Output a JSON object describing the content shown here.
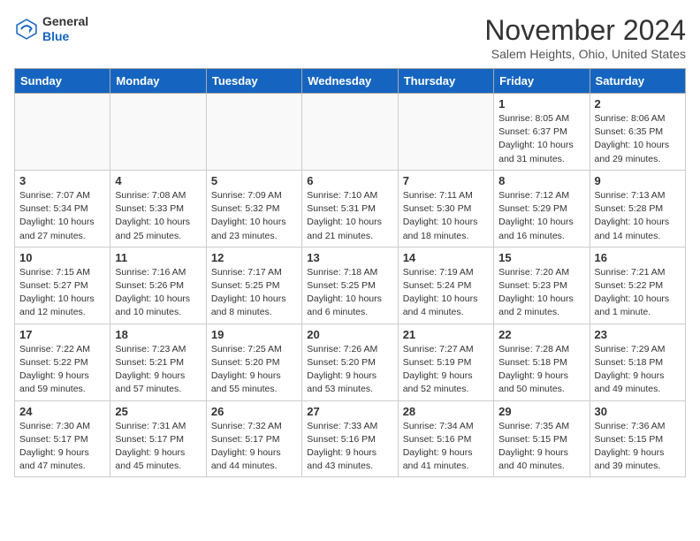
{
  "header": {
    "logo_general": "General",
    "logo_blue": "Blue",
    "month_title": "November 2024",
    "location": "Salem Heights, Ohio, United States"
  },
  "days_of_week": [
    "Sunday",
    "Monday",
    "Tuesday",
    "Wednesday",
    "Thursday",
    "Friday",
    "Saturday"
  ],
  "weeks": [
    [
      {
        "day": "",
        "info": ""
      },
      {
        "day": "",
        "info": ""
      },
      {
        "day": "",
        "info": ""
      },
      {
        "day": "",
        "info": ""
      },
      {
        "day": "",
        "info": ""
      },
      {
        "day": "1",
        "info": "Sunrise: 8:05 AM\nSunset: 6:37 PM\nDaylight: 10 hours and 31 minutes."
      },
      {
        "day": "2",
        "info": "Sunrise: 8:06 AM\nSunset: 6:35 PM\nDaylight: 10 hours and 29 minutes."
      }
    ],
    [
      {
        "day": "3",
        "info": "Sunrise: 7:07 AM\nSunset: 5:34 PM\nDaylight: 10 hours and 27 minutes."
      },
      {
        "day": "4",
        "info": "Sunrise: 7:08 AM\nSunset: 5:33 PM\nDaylight: 10 hours and 25 minutes."
      },
      {
        "day": "5",
        "info": "Sunrise: 7:09 AM\nSunset: 5:32 PM\nDaylight: 10 hours and 23 minutes."
      },
      {
        "day": "6",
        "info": "Sunrise: 7:10 AM\nSunset: 5:31 PM\nDaylight: 10 hours and 21 minutes."
      },
      {
        "day": "7",
        "info": "Sunrise: 7:11 AM\nSunset: 5:30 PM\nDaylight: 10 hours and 18 minutes."
      },
      {
        "day": "8",
        "info": "Sunrise: 7:12 AM\nSunset: 5:29 PM\nDaylight: 10 hours and 16 minutes."
      },
      {
        "day": "9",
        "info": "Sunrise: 7:13 AM\nSunset: 5:28 PM\nDaylight: 10 hours and 14 minutes."
      }
    ],
    [
      {
        "day": "10",
        "info": "Sunrise: 7:15 AM\nSunset: 5:27 PM\nDaylight: 10 hours and 12 minutes."
      },
      {
        "day": "11",
        "info": "Sunrise: 7:16 AM\nSunset: 5:26 PM\nDaylight: 10 hours and 10 minutes."
      },
      {
        "day": "12",
        "info": "Sunrise: 7:17 AM\nSunset: 5:25 PM\nDaylight: 10 hours and 8 minutes."
      },
      {
        "day": "13",
        "info": "Sunrise: 7:18 AM\nSunset: 5:25 PM\nDaylight: 10 hours and 6 minutes."
      },
      {
        "day": "14",
        "info": "Sunrise: 7:19 AM\nSunset: 5:24 PM\nDaylight: 10 hours and 4 minutes."
      },
      {
        "day": "15",
        "info": "Sunrise: 7:20 AM\nSunset: 5:23 PM\nDaylight: 10 hours and 2 minutes."
      },
      {
        "day": "16",
        "info": "Sunrise: 7:21 AM\nSunset: 5:22 PM\nDaylight: 10 hours and 1 minute."
      }
    ],
    [
      {
        "day": "17",
        "info": "Sunrise: 7:22 AM\nSunset: 5:22 PM\nDaylight: 9 hours and 59 minutes."
      },
      {
        "day": "18",
        "info": "Sunrise: 7:23 AM\nSunset: 5:21 PM\nDaylight: 9 hours and 57 minutes."
      },
      {
        "day": "19",
        "info": "Sunrise: 7:25 AM\nSunset: 5:20 PM\nDaylight: 9 hours and 55 minutes."
      },
      {
        "day": "20",
        "info": "Sunrise: 7:26 AM\nSunset: 5:20 PM\nDaylight: 9 hours and 53 minutes."
      },
      {
        "day": "21",
        "info": "Sunrise: 7:27 AM\nSunset: 5:19 PM\nDaylight: 9 hours and 52 minutes."
      },
      {
        "day": "22",
        "info": "Sunrise: 7:28 AM\nSunset: 5:18 PM\nDaylight: 9 hours and 50 minutes."
      },
      {
        "day": "23",
        "info": "Sunrise: 7:29 AM\nSunset: 5:18 PM\nDaylight: 9 hours and 49 minutes."
      }
    ],
    [
      {
        "day": "24",
        "info": "Sunrise: 7:30 AM\nSunset: 5:17 PM\nDaylight: 9 hours and 47 minutes."
      },
      {
        "day": "25",
        "info": "Sunrise: 7:31 AM\nSunset: 5:17 PM\nDaylight: 9 hours and 45 minutes."
      },
      {
        "day": "26",
        "info": "Sunrise: 7:32 AM\nSunset: 5:17 PM\nDaylight: 9 hours and 44 minutes."
      },
      {
        "day": "27",
        "info": "Sunrise: 7:33 AM\nSunset: 5:16 PM\nDaylight: 9 hours and 43 minutes."
      },
      {
        "day": "28",
        "info": "Sunrise: 7:34 AM\nSunset: 5:16 PM\nDaylight: 9 hours and 41 minutes."
      },
      {
        "day": "29",
        "info": "Sunrise: 7:35 AM\nSunset: 5:15 PM\nDaylight: 9 hours and 40 minutes."
      },
      {
        "day": "30",
        "info": "Sunrise: 7:36 AM\nSunset: 5:15 PM\nDaylight: 9 hours and 39 minutes."
      }
    ]
  ]
}
